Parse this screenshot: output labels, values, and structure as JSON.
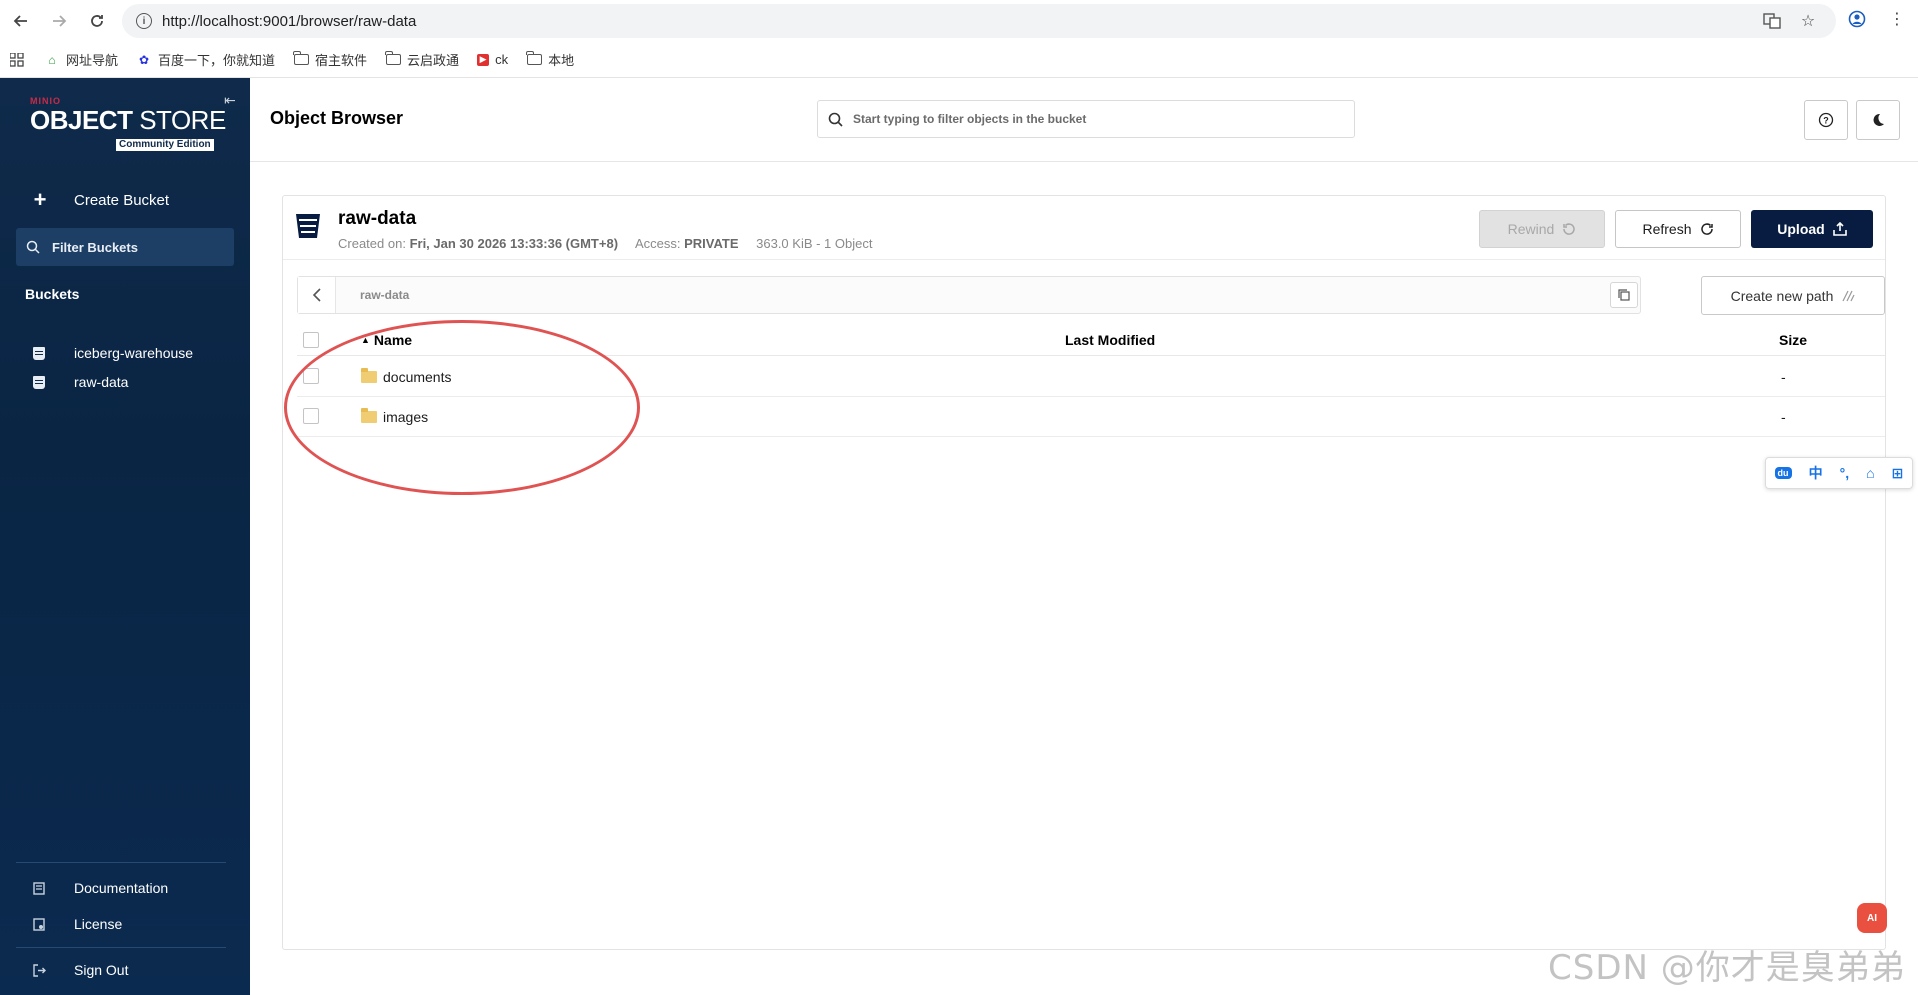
{
  "browser": {
    "url": "http://localhost:9001/browser/raw-data",
    "bookmarks": [
      "网址导航",
      "百度一下，你就知道",
      "宿主软件",
      "云启政通",
      "ck",
      "本地"
    ]
  },
  "sidebar": {
    "logo_minio": "MINIO",
    "logo_brand_bold": "OBJECT",
    "logo_brand_light": " STORE",
    "logo_edition": "Community Edition",
    "create_bucket": "Create Bucket",
    "filter_buckets": "Filter Buckets",
    "buckets_label": "Buckets",
    "buckets": [
      "iceberg-warehouse",
      "raw-data"
    ],
    "documentation": "Documentation",
    "license": "License",
    "sign_out": "Sign Out"
  },
  "header": {
    "title": "Object Browser",
    "search_placeholder": "Start typing to filter objects in the bucket"
  },
  "bucket": {
    "name": "raw-data",
    "created_label": "Created on:",
    "created_value": "Fri, Jan 30 2026 13:33:36 (GMT+8)",
    "access_label": "Access:",
    "access_value": "PRIVATE",
    "usage": "363.0 KiB - 1 Object",
    "rewind": "Rewind",
    "refresh": "Refresh",
    "upload": "Upload",
    "path": "raw-data",
    "create_new_path": "Create new path"
  },
  "table": {
    "col_name": "Name",
    "col_modified": "Last Modified",
    "col_size": "Size",
    "rows": [
      {
        "name": "documents",
        "modified": "",
        "size": "-"
      },
      {
        "name": "images",
        "modified": "",
        "size": "-"
      }
    ]
  },
  "ime": {
    "chinese": "中"
  },
  "ai_badge": "AI",
  "watermark": "CSDN @你才是臭弟弟",
  "colors": {
    "sidebar_bg": "#0f2a4a",
    "upload_bg": "#081c42",
    "annotation": "#e05353",
    "folder": "#f0cd73"
  }
}
